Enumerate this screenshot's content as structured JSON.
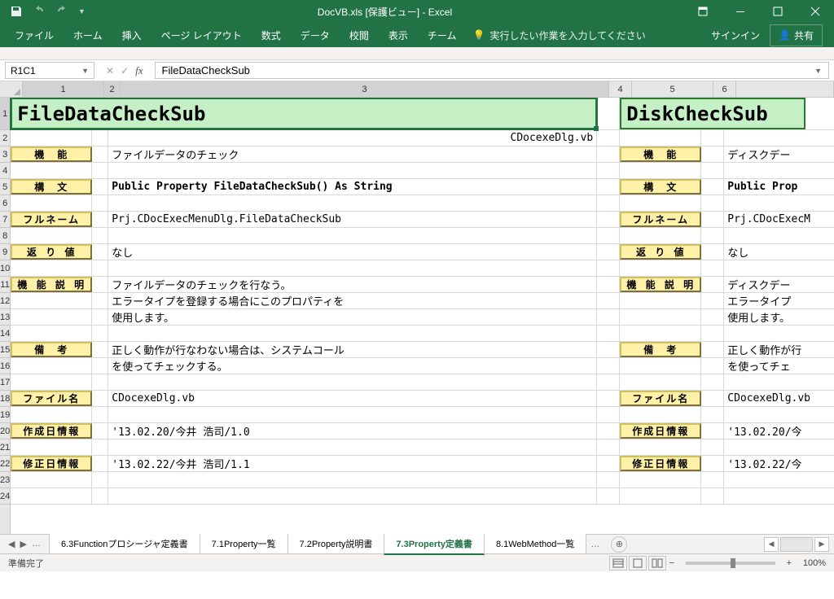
{
  "titlebar": {
    "title": "DocVB.xls [保護ビュー] - Excel"
  },
  "ribbon": {
    "tabs": [
      "ファイル",
      "ホーム",
      "挿入",
      "ページ レイアウト",
      "数式",
      "データ",
      "校閲",
      "表示",
      "チーム"
    ],
    "tell_me": "実行したい作業を入力してください",
    "signin": "サインイン",
    "share": "共有"
  },
  "formula_bar": {
    "name_box": "R1C1",
    "formula": "FileDataCheckSub"
  },
  "columns": [
    "1",
    "2",
    "3",
    "4",
    "5",
    "6"
  ],
  "rows_nums": [
    "1",
    "2",
    "3",
    "4",
    "5",
    "6",
    "7",
    "8",
    "9",
    "10",
    "11",
    "12",
    "13",
    "14",
    "15",
    "16",
    "17",
    "18",
    "19",
    "20",
    "21",
    "22",
    "23",
    "24"
  ],
  "doc1": {
    "title": "FileDataCheckSub",
    "source_file": "CDocexeDlg.vb",
    "labels": {
      "kinou": "機　能",
      "koubun": "構　文",
      "fullname": "フルネーム",
      "return": "返 り 値",
      "desc": "機 能 説 明",
      "notes": "備　考",
      "filename": "ファイル名",
      "created": "作成日情報",
      "modified": "修正日情報"
    },
    "values": {
      "kinou": "ファイルデータのチェック",
      "koubun": "Public Property FileDataCheckSub() As String",
      "fullname": "Prj.CDocExecMenuDlg.FileDataCheckSub",
      "return": "なし",
      "desc1": "ファイルデータのチェックを行なう。",
      "desc2": "エラータイプを登録する場合にこのプロパティを",
      "desc3": "使用します。",
      "notes1": "正しく動作が行なわない場合は、システムコール",
      "notes2": "を使ってチェックする。",
      "filename": "CDocexeDlg.vb",
      "created": "'13.02.20/今井 浩司/1.0",
      "modified": "'13.02.22/今井 浩司/1.1"
    }
  },
  "doc2": {
    "title": "DiskCheckSub",
    "values": {
      "kinou": "ディスクデー",
      "koubun": "Public Prop",
      "fullname": "Prj.CDocExecM",
      "return": "なし",
      "desc1": "ディスクデー",
      "desc2": "エラータイプ",
      "desc3": "使用します。",
      "notes1": "正しく動作が行",
      "notes2": "を使ってチェ",
      "filename": "CDocexeDlg.vb",
      "created": "'13.02.20/今",
      "modified": "'13.02.22/今"
    }
  },
  "sheet_tabs": {
    "tabs": [
      "6.3Functionプロシージャ定義書",
      "7.1Property一覧",
      "7.2Property説明書",
      "7.3Property定義書",
      "8.1WebMethod一覧"
    ],
    "active_index": 3
  },
  "status": {
    "ready": "準備完了",
    "zoom": "100%"
  }
}
